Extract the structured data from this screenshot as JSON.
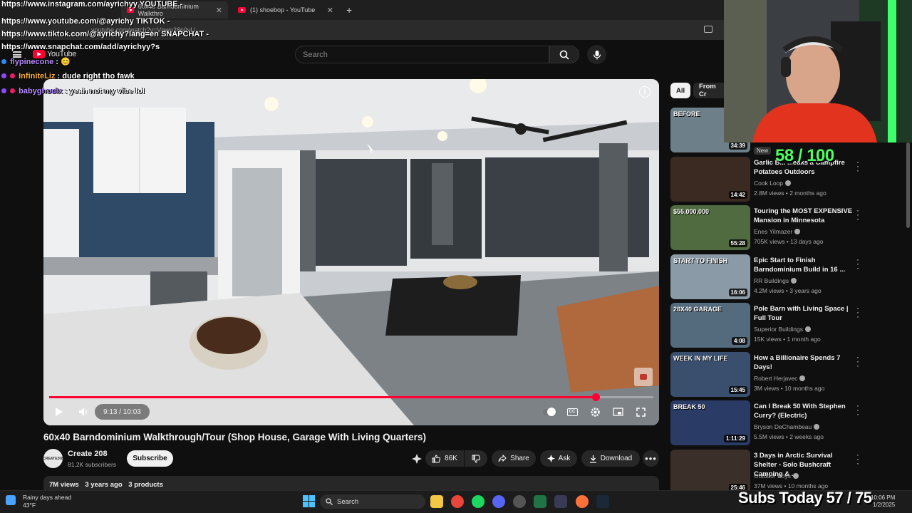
{
  "browser": {
    "tabs": [
      {
        "label": "60x40 Barndominium Walkthro",
        "active": true
      },
      {
        "label": "(1) shoebop - YouTube",
        "active": false
      }
    ],
    "url": "youtube.com/watch?v=Vnwn28n0vLl"
  },
  "youtube": {
    "logo": "YouTube",
    "search_placeholder": "Search"
  },
  "player": {
    "time": "9:13 / 10:03",
    "progress": 0.905
  },
  "video": {
    "title": "60x40 Barndominium Walkthrough/Tour (Shop House, Garage With Living Quarters)",
    "channel": "Create 208",
    "channel_avatar_text": "CREATE208",
    "subscribers": "81.2K subscribers",
    "subscribe_label": "Subscribe",
    "likes": "86K",
    "share_label": "Share",
    "ask_label": "Ask",
    "download_label": "Download",
    "views": "7M views",
    "age": "3 years ago",
    "products": "3 products"
  },
  "sidebar": {
    "chips": [
      "All",
      "From Cr"
    ],
    "new_badge": "New",
    "items": [
      {
        "title": "",
        "channel": "",
        "meta": "",
        "duration": "34:39",
        "thumb_text": "BEFORE"
      },
      {
        "title": "Garlic B... ...eaks a Campfire Potatoes Outdoors",
        "channel": "Cook Loop",
        "meta": "2.8M views • 2 months ago",
        "duration": "14:42",
        "thumb_text": ""
      },
      {
        "title": "Touring the MOST EXPENSIVE Mansion in Minnesota",
        "channel": "Enes Yilmazer",
        "meta": "705K views • 13 days ago",
        "duration": "55:28",
        "thumb_text": "$55,000,000"
      },
      {
        "title": "Epic Start to Finish Barndominium Build in 16 ...",
        "channel": "RR Buildings",
        "meta": "4.2M views • 3 years ago",
        "duration": "16:06",
        "thumb_text": "START TO FINISH"
      },
      {
        "title": "Pole Barn with Living Space | Full Tour",
        "channel": "Superior Buildings",
        "meta": "15K views • 1 month ago",
        "duration": "4:08",
        "thumb_text": "26X40 GARAGE"
      },
      {
        "title": "How a Billionaire Spends 7 Days!",
        "channel": "Robert Herjavec",
        "meta": "3M views • 10 months ago",
        "duration": "15:45",
        "thumb_text": "WEEK IN MY LIFE"
      },
      {
        "title": "Can I Break 50 With Stephen Curry? (Electric)",
        "channel": "Bryson DeChambeau",
        "meta": "5.5M views • 2 weeks ago",
        "duration": "1:11:29",
        "thumb_text": "BREAK 50"
      },
      {
        "title": "3 Days in Arctic Survival Shelter - Solo Bushcraft Camping & ...",
        "channel": "Outdoor Boys",
        "meta": "37M views • 10 months ago",
        "duration": "25:46",
        "thumb_text": ""
      }
    ]
  },
  "overlay": {
    "links": [
      "https://www.instagram.com/ayrichyy YOUTUBE -",
      "https://www.youtube.com/@ayrichy TIKTOK -",
      "https://www.tiktok.com/@ayrichy?lang=en SNAPCHAT -",
      "https://www.snapchat.com/add/ayrichyy?s"
    ],
    "chat": [
      {
        "user": "flypinecone",
        "message": ": 😊"
      },
      {
        "user": "InfiniteLiz",
        "message": ": dude right tho fawk"
      },
      {
        "user": "babyghoulx",
        "message": ": yeah not my vibe lol"
      }
    ],
    "counter": "58 / 100",
    "subs_today": "Subs Today  57 / 75"
  },
  "taskbar": {
    "weather_title": "Rainy days ahead",
    "weather_temp": "43°F",
    "search_label": "Search",
    "time": "10:06 PM",
    "date": "1/2/2025"
  },
  "colors": {
    "accent_red": "#ff0033",
    "counter_green": "#4cff60",
    "background": "#0f0f0f"
  }
}
